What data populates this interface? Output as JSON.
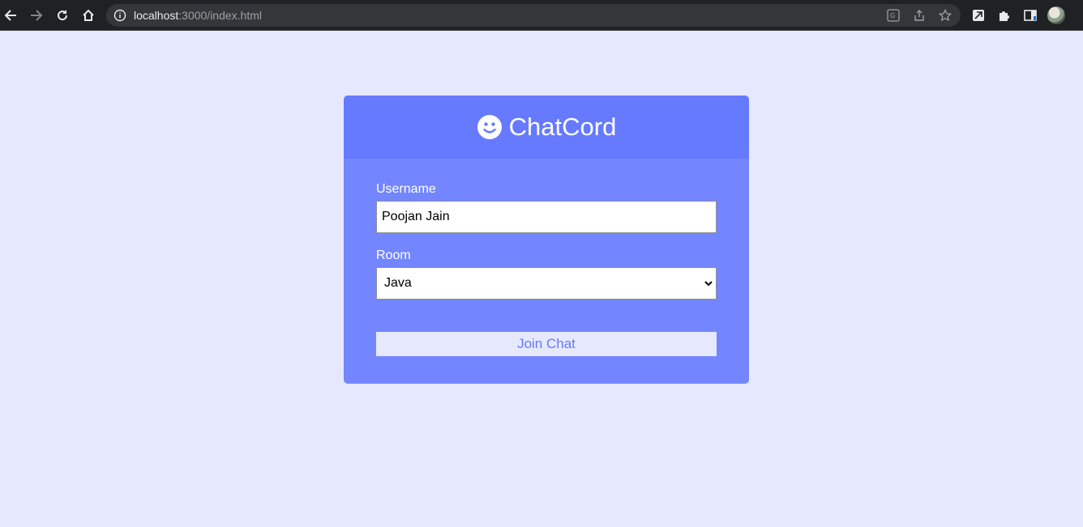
{
  "browser": {
    "url_host": "localhost",
    "url_path": ":3000/index.html"
  },
  "app": {
    "title": "ChatCord"
  },
  "form": {
    "username_label": "Username",
    "username_value": "Poojan Jain",
    "room_label": "Room",
    "room_value": "Java",
    "submit_label": "Join Chat"
  },
  "colors": {
    "page_bg": "#e6e9fd",
    "header_bg": "#667aff",
    "card_bg": "#7386ff",
    "button_text": "#667aff"
  },
  "icons": {
    "back": "arrow-left-icon",
    "forward": "arrow-right-icon",
    "reload": "reload-icon",
    "home": "home-icon",
    "info": "info-icon",
    "translate": "translate-icon",
    "share": "share-icon",
    "bookmark": "star-icon",
    "extension1": "extension-icon",
    "extensions": "puzzle-icon",
    "sidepanel": "side-panel-icon",
    "logo": "smile-icon"
  }
}
